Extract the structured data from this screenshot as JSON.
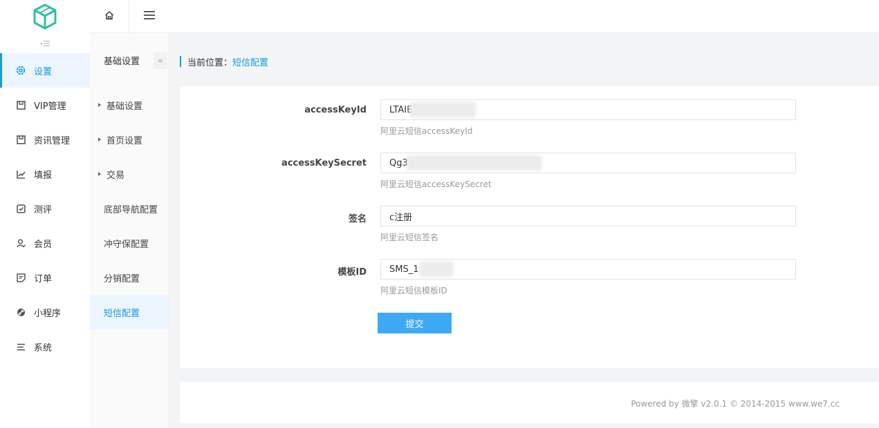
{
  "sidebar": {
    "logo": "cube-logo",
    "items": [
      {
        "label": "设置",
        "icon": "gear-icon",
        "active": true
      },
      {
        "label": "VIP管理",
        "icon": "box-icon"
      },
      {
        "label": "资讯管理",
        "icon": "box-icon"
      },
      {
        "label": "填报",
        "icon": "chart-line-icon"
      },
      {
        "label": "测评",
        "icon": "check-square-icon"
      },
      {
        "label": "会员",
        "icon": "user-icon"
      },
      {
        "label": "订单",
        "icon": "document-icon"
      },
      {
        "label": "小程序",
        "icon": "link-icon"
      },
      {
        "label": "系统",
        "icon": "list-icon"
      }
    ]
  },
  "topbar": {
    "home_icon": "home-icon",
    "menu_icon": "hamburger-icon"
  },
  "subnav": {
    "title": "基础设置",
    "collapse_glyph": "«",
    "items": [
      {
        "label": "基础设置",
        "has_arrow": true
      },
      {
        "label": "首页设置",
        "has_arrow": true
      },
      {
        "label": "交易",
        "has_arrow": true
      },
      {
        "label": "底部导航配置"
      },
      {
        "label": "冲守保配置"
      },
      {
        "label": "分销配置"
      },
      {
        "label": "短信配置",
        "active": true
      }
    ]
  },
  "breadcrumb": {
    "prefix": "当前位置：",
    "current": "短信配置"
  },
  "form": {
    "fields": [
      {
        "label": "accessKeyId",
        "value": "LTAIE",
        "help": "阿里云短信accessKeyId"
      },
      {
        "label": "accessKeySecret",
        "value": "Qg3",
        "help": "阿里云短信accessKeySecret"
      },
      {
        "label": "签名",
        "value": "c注册",
        "help": "阿里云短信签名"
      },
      {
        "label": "模板ID",
        "value": "SMS_1",
        "help": "阿里云短信模板ID"
      }
    ],
    "submit_label": "提交"
  },
  "footer": {
    "text": "Powered by 微擎 v2.0.1 © 2014-2015 www.we7.cc"
  },
  "colors": {
    "accent": "#1a9bd7",
    "button": "#3da9f5",
    "logo": "#2fbfa0"
  }
}
